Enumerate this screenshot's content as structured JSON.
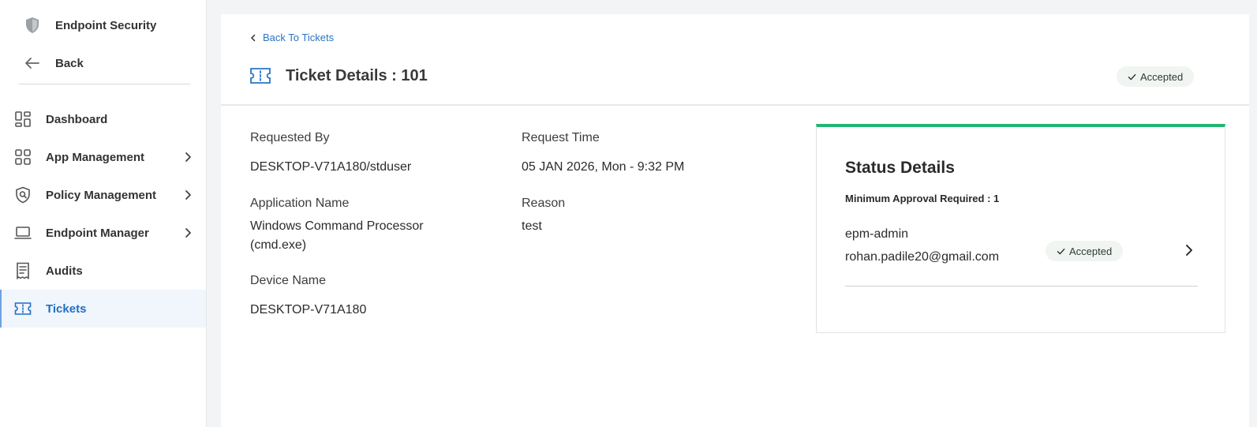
{
  "sidebar": {
    "app_title": "Endpoint Security",
    "back_label": "Back",
    "items": [
      {
        "label": "Dashboard",
        "icon": "dashboard-icon"
      },
      {
        "label": "App Management",
        "icon": "apps-grid-icon"
      },
      {
        "label": "Policy Management",
        "icon": "policy-shield-icon"
      },
      {
        "label": "Endpoint Manager",
        "icon": "laptop-icon"
      },
      {
        "label": "Audits",
        "icon": "audit-document-icon"
      },
      {
        "label": "Tickets",
        "icon": "ticket-icon"
      }
    ]
  },
  "header": {
    "back_link": "Back To Tickets",
    "title": "Ticket Details : 101",
    "status": "Accepted"
  },
  "details": {
    "requested_by_label": "Requested By",
    "requested_by": "DESKTOP-V71A180/stduser",
    "request_time_label": "Request Time",
    "request_time": "05 JAN 2026, Mon - 9:32 PM",
    "application_name_label": "Application Name",
    "application_name_line1": "Windows Command Processor",
    "application_name_line2": "(cmd.exe)",
    "reason_label": "Reason",
    "reason": "test",
    "device_name_label": "Device Name",
    "device_name": "DESKTOP-V71A180"
  },
  "status_details": {
    "title": "Status Details",
    "min_approval": "Minimum Approval Required : 1",
    "approver": {
      "name": "epm-admin",
      "email": "rohan.padile20@gmail.com",
      "status": "Accepted"
    }
  },
  "colors": {
    "accent": "#1f6fc5",
    "status_bar": "#22b573",
    "badge_bg": "#f0f5f2"
  }
}
